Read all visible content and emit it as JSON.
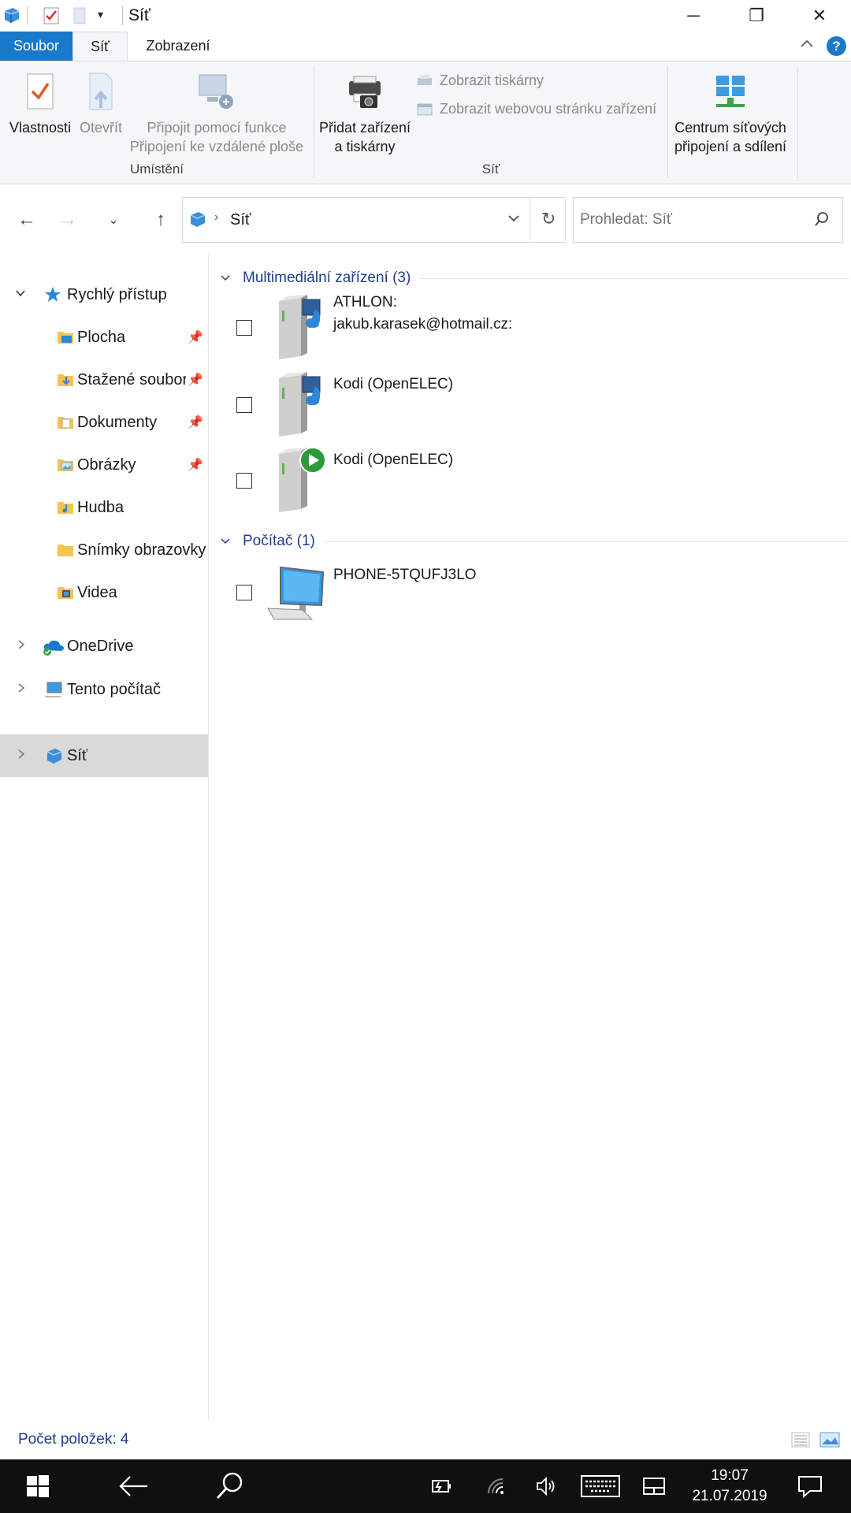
{
  "window": {
    "title": "Síť",
    "minimize_glyph": "─",
    "restore_glyph": "❐",
    "close_glyph": "✕"
  },
  "tabs": {
    "file": "Soubor",
    "network": "Síť",
    "view": "Zobrazení"
  },
  "ribbon": {
    "properties": "Vlastnosti",
    "open": "Otevřít",
    "connect_line1": "Připojit pomocí funkce",
    "connect_line2": "Připojení ke vzdálené ploše",
    "group_location": "Umístění",
    "add_devices_line1": "Přidat zařízení",
    "add_devices_line2": "a tiskárny",
    "show_printers": "Zobrazit tiskárny",
    "show_device_webpage": "Zobrazit webovou stránku zařízení",
    "group_network": "Síť",
    "network_center_line1": "Centrum síťových",
    "network_center_line2": "připojení a sdílení"
  },
  "navigation": {
    "address_path": "Síť",
    "search_placeholder": "Prohledat: Síť"
  },
  "sidebar": {
    "quick_access": "Rychlý přístup",
    "items": [
      {
        "label": "Plocha",
        "pinned": true
      },
      {
        "label": "Stažené soubory",
        "pinned": true
      },
      {
        "label": "Dokumenty",
        "pinned": true
      },
      {
        "label": "Obrázky",
        "pinned": true
      },
      {
        "label": "Hudba",
        "pinned": false
      },
      {
        "label": "Snímky obrazovky",
        "pinned": false
      },
      {
        "label": "Videa",
        "pinned": false
      }
    ],
    "onedrive": "OneDrive",
    "this_pc": "Tento počítač",
    "network": "Síť"
  },
  "content": {
    "group_media": "Multimediální zařízení (3)",
    "media_items": [
      {
        "line1": "ATHLON:",
        "line2": "jakub.karasek@hotmail.cz:"
      },
      {
        "line1": "Kodi (OpenELEC)",
        "line2": ""
      },
      {
        "line1": "Kodi (OpenELEC)",
        "line2": ""
      }
    ],
    "group_computer": "Počítač (1)",
    "computer_items": [
      {
        "line1": "PHONE-5TQUFJ3LO"
      }
    ]
  },
  "status": {
    "item_count": "Počet položek: 4"
  },
  "taskbar": {
    "time": "19:07",
    "date": "21.07.2019"
  },
  "colors": {
    "accent": "#1979ca",
    "link_blue": "#1e3d8f",
    "selected_bg": "#d9d9d9",
    "taskbar_bg": "#101010"
  }
}
